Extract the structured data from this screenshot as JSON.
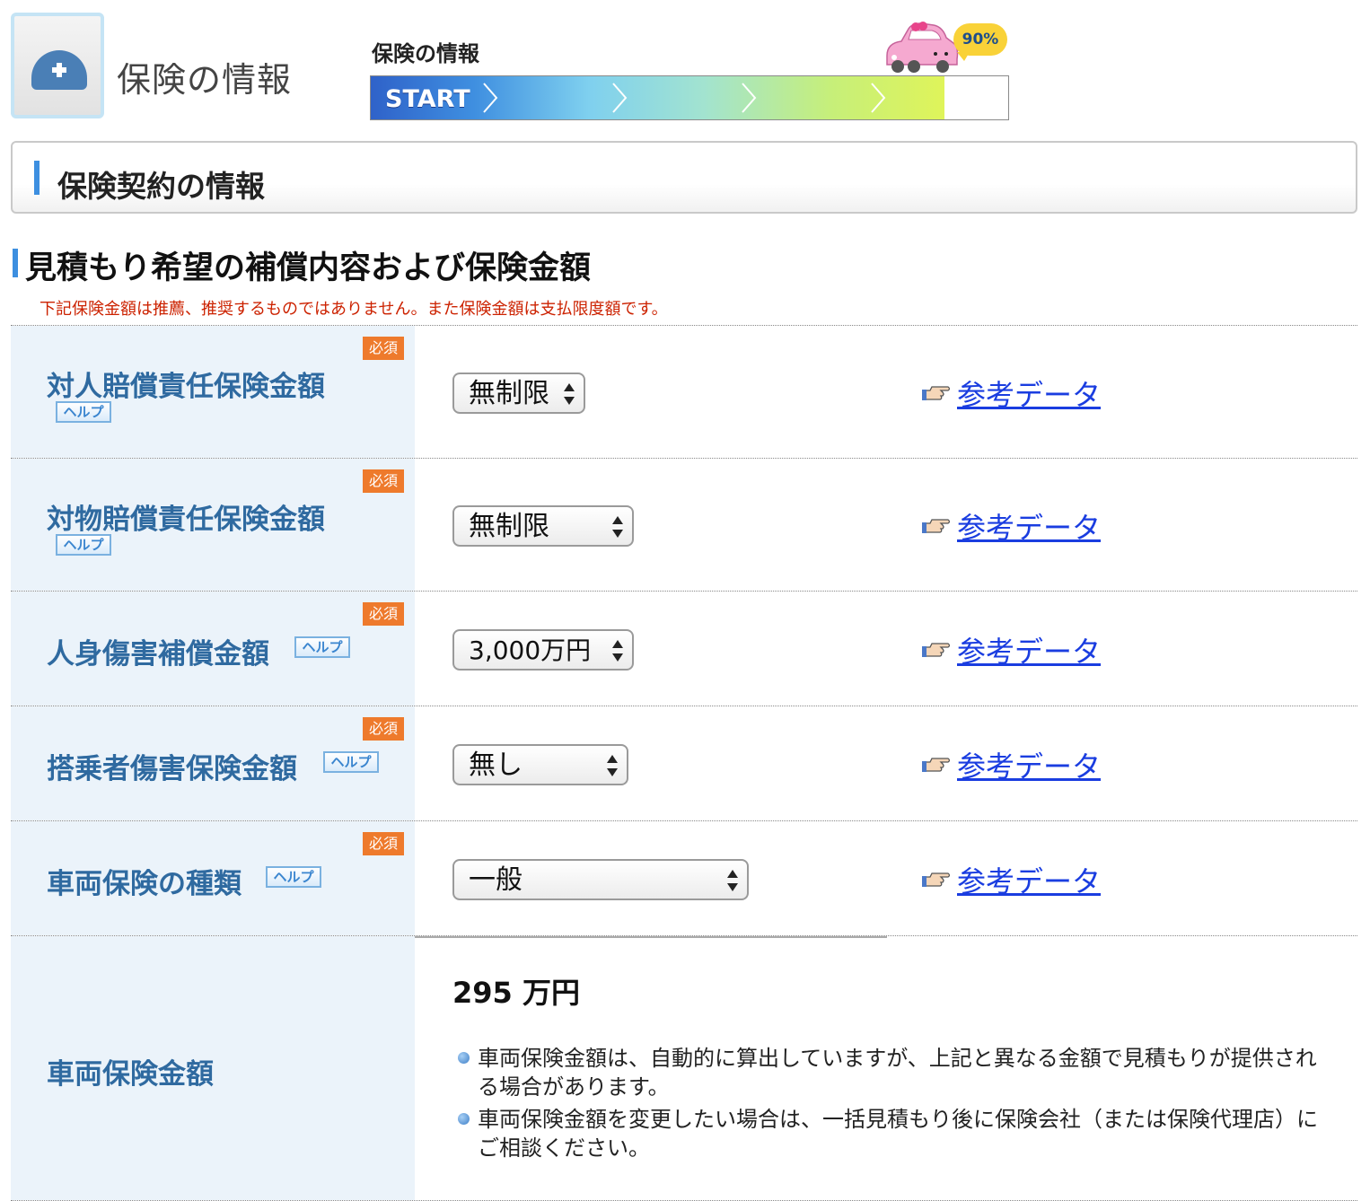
{
  "header": {
    "title": "保険の情報",
    "progress_label": "保険の情報",
    "progress_start": "START",
    "progress_percent": 0.9,
    "progress_badge": "90%"
  },
  "section": {
    "title": "保険契約の情報"
  },
  "subsection": {
    "title": "見積もり希望の補償内容および保険金額",
    "notice": "下記保険金額は推薦、推奨するものではありません。また保険金額は支払限度額です。"
  },
  "labels": {
    "required": "必須",
    "help": "ヘルプ",
    "reference": "参考データ"
  },
  "rows": [
    {
      "label": "対人賠償責任保険金額",
      "value": "無制限"
    },
    {
      "label": "対物賠償責任保険金額",
      "value": "無制限"
    },
    {
      "label": "人身傷害補償金額",
      "value": "3,000万円"
    },
    {
      "label": "搭乗者傷害保険金額",
      "value": "無し"
    },
    {
      "label": "車両保険の種類",
      "value": "一般"
    }
  ],
  "vehicle_amount": {
    "label": "車両保険金額",
    "value": "295 万円",
    "notes": [
      "車両保険金額は、自動的に算出していますが、上記と異なる金額で見積もりが提供される場合があります。",
      "車両保険金額を変更したい場合は、一括見積もり後に保険会社（または保険代理店）にご相談ください。"
    ]
  },
  "colors": {
    "accent": "#3d8fe0",
    "label_text": "#2f6aa0",
    "label_bg": "#ebf3fa",
    "required_badge": "#ee7a2c",
    "notice_text": "#cc2200",
    "link": "#1a3de0"
  },
  "icons": [
    "insurance-dome-icon",
    "pointing-hand-icon",
    "car-mascot-icon",
    "select-arrows-icon"
  ]
}
